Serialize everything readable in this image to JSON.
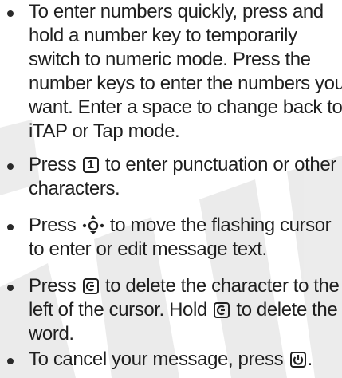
{
  "watermark": {
    "text": "DRAFT"
  },
  "bullets": [
    {
      "lines": [
        "To enter numbers quickly, press and",
        "hold a number key to temporarily",
        "switch to numeric mode. Press the",
        "number keys to enter the numbers you",
        "want. Enter a space to change back to",
        "iTAP or Tap mode."
      ]
    },
    {
      "line1_before": "Press",
      "key_label": "1",
      "line1_after": "to enter punctuation or other",
      "line2": "characters."
    },
    {
      "line1_before": "Press",
      "line1_after": "to move the flashing cursor",
      "line2": "to enter or edit message text."
    },
    {
      "line1_before": "Press",
      "line1_after": "to delete the character to the",
      "line2_before": "left of the cursor. Hold",
      "line2_after": "to delete the",
      "line3": "word."
    },
    {
      "line1_before": "To cancel your message, press",
      "line1_after": "."
    }
  ],
  "icons": [
    "one-key-icon",
    "nav-key-icon",
    "clear-key-icon",
    "end-key-icon"
  ]
}
